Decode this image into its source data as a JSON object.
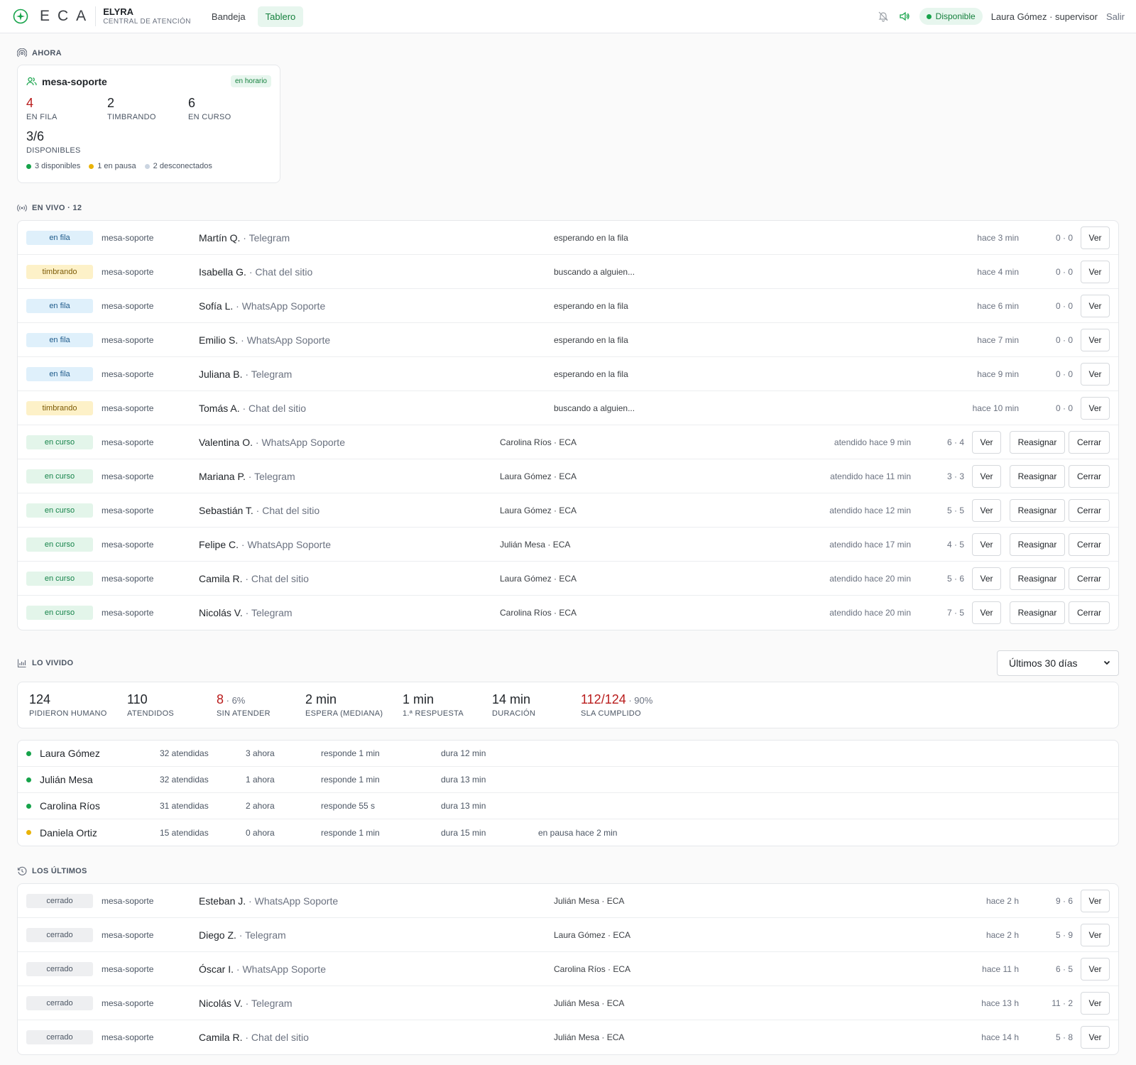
{
  "header": {
    "brand_letters": "ECA",
    "app_name": "ELYRA",
    "app_subtitle": "CENTRAL DE ATENCIÓN",
    "nav": [
      {
        "label": "Bandeja",
        "active": false
      },
      {
        "label": "Tablero",
        "active": true
      }
    ],
    "status": "Disponible",
    "user": "Laura Gómez · supervisor",
    "logout": "Salir",
    "icons": [
      "bell-off-icon",
      "speaker-icon"
    ]
  },
  "colors": {
    "accent": "#15803d",
    "accent_bg": "#e7f6ee",
    "danger": "#b91c1c",
    "available": "#16a34a",
    "paused": "#eab308",
    "offline": "#cbd5e1"
  },
  "now": {
    "title": "AHORA",
    "queue": {
      "name": "mesa-soporte",
      "badge": "en horario",
      "stats": [
        {
          "value": "4",
          "label": "EN FILA",
          "highlight": true
        },
        {
          "value": "2",
          "label": "TIMBRANDO",
          "highlight": false
        },
        {
          "value": "6",
          "label": "EN CURSO",
          "highlight": false
        }
      ],
      "available": {
        "value": "3/6",
        "label": "DISPONIBLES"
      },
      "legend": [
        {
          "text": "3 disponibles",
          "color": "#16a34a"
        },
        {
          "text": "1 en pausa",
          "color": "#eab308"
        },
        {
          "text": "2 desconectados",
          "color": "#cbd5e1"
        }
      ]
    }
  },
  "live": {
    "title": "EN VIVO · 12",
    "rows": [
      {
        "status": "en fila",
        "kind": "fila",
        "queue": "mesa-soporte",
        "client": "Martín Q.",
        "channel": "Telegram",
        "note": "esperando en la fila",
        "time": "hace 3 min",
        "count": "0 · 0",
        "actions": [
          "Ver"
        ]
      },
      {
        "status": "timbrando",
        "kind": "timbrando",
        "queue": "mesa-soporte",
        "client": "Isabella G.",
        "channel": "Chat del sitio",
        "note": "buscando a alguien...",
        "time": "hace 4 min",
        "count": "0 · 0",
        "actions": [
          "Ver"
        ]
      },
      {
        "status": "en fila",
        "kind": "fila",
        "queue": "mesa-soporte",
        "client": "Sofía L.",
        "channel": "WhatsApp Soporte",
        "note": "esperando en la fila",
        "time": "hace 6 min",
        "count": "0 · 0",
        "actions": [
          "Ver"
        ]
      },
      {
        "status": "en fila",
        "kind": "fila",
        "queue": "mesa-soporte",
        "client": "Emilio S.",
        "channel": "WhatsApp Soporte",
        "note": "esperando en la fila",
        "time": "hace 7 min",
        "count": "0 · 0",
        "actions": [
          "Ver"
        ]
      },
      {
        "status": "en fila",
        "kind": "fila",
        "queue": "mesa-soporte",
        "client": "Juliana B.",
        "channel": "Telegram",
        "note": "esperando en la fila",
        "time": "hace 9 min",
        "count": "0 · 0",
        "actions": [
          "Ver"
        ]
      },
      {
        "status": "timbrando",
        "kind": "timbrando",
        "queue": "mesa-soporte",
        "client": "Tomás A.",
        "channel": "Chat del sitio",
        "note": "buscando a alguien...",
        "time": "hace 10 min",
        "count": "0 · 0",
        "actions": [
          "Ver"
        ]
      },
      {
        "status": "en curso",
        "kind": "curso",
        "queue": "mesa-soporte",
        "client": "Valentina O.",
        "channel": "WhatsApp Soporte",
        "note": "Carolina Ríos · ECA",
        "time": "atendido hace 9 min",
        "count": "6 · 4",
        "actions": [
          "Ver",
          "Reasignar",
          "Cerrar"
        ]
      },
      {
        "status": "en curso",
        "kind": "curso",
        "queue": "mesa-soporte",
        "client": "Mariana P.",
        "channel": "Telegram",
        "note": "Laura Gómez · ECA",
        "time": "atendido hace 11 min",
        "count": "3 · 3",
        "actions": [
          "Ver",
          "Reasignar",
          "Cerrar"
        ]
      },
      {
        "status": "en curso",
        "kind": "curso",
        "queue": "mesa-soporte",
        "client": "Sebastián T.",
        "channel": "Chat del sitio",
        "note": "Laura Gómez · ECA",
        "time": "atendido hace 12 min",
        "count": "5 · 5",
        "actions": [
          "Ver",
          "Reasignar",
          "Cerrar"
        ]
      },
      {
        "status": "en curso",
        "kind": "curso",
        "queue": "mesa-soporte",
        "client": "Felipe C.",
        "channel": "WhatsApp Soporte",
        "note": "Julián Mesa · ECA",
        "time": "atendido hace 17 min",
        "count": "4 · 5",
        "actions": [
          "Ver",
          "Reasignar",
          "Cerrar"
        ]
      },
      {
        "status": "en curso",
        "kind": "curso",
        "queue": "mesa-soporte",
        "client": "Camila R.",
        "channel": "Chat del sitio",
        "note": "Laura Gómez · ECA",
        "time": "atendido hace 20 min",
        "count": "5 · 6",
        "actions": [
          "Ver",
          "Reasignar",
          "Cerrar"
        ]
      },
      {
        "status": "en curso",
        "kind": "curso",
        "queue": "mesa-soporte",
        "client": "Nicolás V.",
        "channel": "Telegram",
        "note": "Carolina Ríos · ECA",
        "time": "atendido hace 20 min",
        "count": "7 · 5",
        "actions": [
          "Ver",
          "Reasignar",
          "Cerrar"
        ]
      }
    ]
  },
  "history": {
    "title": "LO VIVIDO",
    "period": "Últimos 30 días",
    "metrics": [
      {
        "value": "124",
        "sub": "",
        "label": "PIDIERON HUMANO",
        "red": false
      },
      {
        "value": "110",
        "sub": "",
        "label": "ATENDIDOS",
        "red": false
      },
      {
        "value": "8",
        "sub": " · 6%",
        "label": "SIN ATENDER",
        "red": true
      },
      {
        "value": "2 min",
        "sub": "",
        "label": "ESPERA (MEDIANA)",
        "red": false
      },
      {
        "value": "1 min",
        "sub": "",
        "label": "1.ª RESPUESTA",
        "red": false
      },
      {
        "value": "14 min",
        "sub": "",
        "label": "DURACIÓN",
        "red": false
      },
      {
        "value": "112/124",
        "sub": " · 90%",
        "label": "SLA CUMPLIDO",
        "red": true
      }
    ],
    "agents": [
      {
        "name": "Laura Gómez",
        "dot": "#16a34a",
        "handled": "32 atendidas",
        "now": "3 ahora",
        "response": "responde 1 min",
        "duration": "dura 12 min",
        "extra": ""
      },
      {
        "name": "Julián Mesa",
        "dot": "#16a34a",
        "handled": "32 atendidas",
        "now": "1 ahora",
        "response": "responde 1 min",
        "duration": "dura 13 min",
        "extra": ""
      },
      {
        "name": "Carolina Ríos",
        "dot": "#16a34a",
        "handled": "31 atendidas",
        "now": "2 ahora",
        "response": "responde 55 s",
        "duration": "dura 13 min",
        "extra": ""
      },
      {
        "name": "Daniela Ortiz",
        "dot": "#eab308",
        "handled": "15 atendidas",
        "now": "0 ahora",
        "response": "responde 1 min",
        "duration": "dura 15 min",
        "extra": "en pausa hace 2 min"
      }
    ]
  },
  "recent": {
    "title": "LOS ÚLTIMOS",
    "rows": [
      {
        "status": "cerrado",
        "kind": "cerrado",
        "queue": "mesa-soporte",
        "client": "Esteban J.",
        "channel": "WhatsApp Soporte",
        "note": "Julián Mesa · ECA",
        "time": "hace 2 h",
        "count": "9 · 6",
        "actions": [
          "Ver"
        ]
      },
      {
        "status": "cerrado",
        "kind": "cerrado",
        "queue": "mesa-soporte",
        "client": "Diego Z.",
        "channel": "Telegram",
        "note": "Laura Gómez · ECA",
        "time": "hace 2 h",
        "count": "5 · 9",
        "actions": [
          "Ver"
        ]
      },
      {
        "status": "cerrado",
        "kind": "cerrado",
        "queue": "mesa-soporte",
        "client": "Óscar I.",
        "channel": "WhatsApp Soporte",
        "note": "Carolina Ríos · ECA",
        "time": "hace 11 h",
        "count": "6 · 5",
        "actions": [
          "Ver"
        ]
      },
      {
        "status": "cerrado",
        "kind": "cerrado",
        "queue": "mesa-soporte",
        "client": "Nicolás V.",
        "channel": "Telegram",
        "note": "Julián Mesa · ECA",
        "time": "hace 13 h",
        "count": "11 · 2",
        "actions": [
          "Ver"
        ]
      },
      {
        "status": "cerrado",
        "kind": "cerrado",
        "queue": "mesa-soporte",
        "client": "Camila R.",
        "channel": "Chat del sitio",
        "note": "Julián Mesa · ECA",
        "time": "hace 14 h",
        "count": "5 · 8",
        "actions": [
          "Ver"
        ]
      }
    ]
  }
}
